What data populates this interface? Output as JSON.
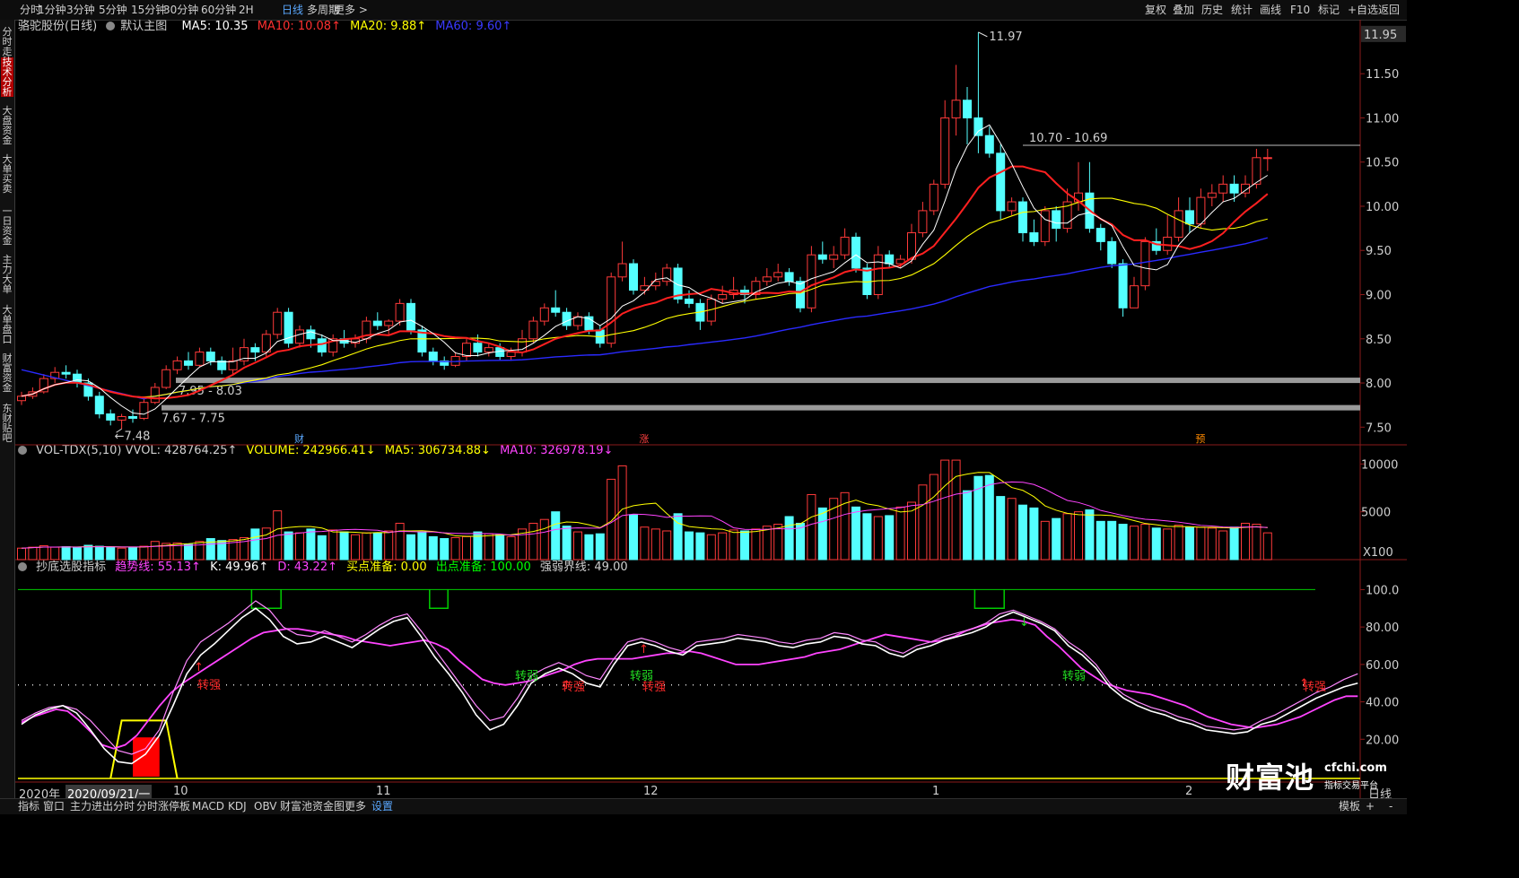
{
  "toolbar": {
    "periods": [
      "分时",
      "1分钟",
      "3分钟",
      "5分钟",
      "15分钟",
      "30分钟",
      "60分钟",
      "2H",
      "日线",
      "多周期",
      "更多 >"
    ],
    "active_period": "日线",
    "right_buttons": [
      "复权",
      "叠加",
      "历史",
      "统计",
      "画线",
      "F10",
      "标记",
      "+自选",
      "返回"
    ]
  },
  "sidebar": {
    "items": [
      "分时走势",
      "技术分析",
      "大盘资金",
      "大单买卖",
      "一日资金",
      "主力大单",
      "大单盘口",
      "财富资金",
      "东财贴吧"
    ],
    "active_item": "技术分析"
  },
  "main_panel": {
    "stock": "骆驼股份(日线)",
    "template": "默认主图",
    "ma5": "MA5: 10.35",
    "ma10": "MA10: 10.08↑",
    "ma20": "MA20: 9.88↑",
    "ma60": "MA60: 9.60↑",
    "price_current": "11.95",
    "high_label": "11.97",
    "low_label": "7.48",
    "zone_top": "10.70 - 10.69",
    "zone_mid": "7.95 - 8.03",
    "zone_low": "7.67 - 7.75",
    "markers": [
      "财",
      "涨",
      "预"
    ],
    "y_ticks": [
      "11.50",
      "11.00",
      "10.50",
      "10.00",
      "9.50",
      "9.00",
      "8.50",
      "8.00",
      "7.50"
    ]
  },
  "volume_panel": {
    "name": "VOL-TDX(5,10)",
    "vvol": "VVOL: 428764.25↑",
    "volume": "VOLUME: 242966.41↓",
    "ma5": "MA5: 306734.88↓",
    "ma10": "MA10: 326978.19↓",
    "y_ticks": [
      "10000",
      "5000"
    ],
    "unit": "X100"
  },
  "indicator_panel": {
    "name": "抄底选股指标",
    "trend": "趋势线: 55.13↑",
    "k": "K: 49.96↑",
    "d": "D: 43.22↑",
    "buy_prep": "买点准备: 0.00",
    "exit_prep": "出点准备: 100.00",
    "strength": "强弱界线: 49.00",
    "y_ticks": [
      "100.0",
      "80.00",
      "60.00",
      "40.00",
      "20.00"
    ],
    "signals": [
      "转强",
      "转弱",
      "转强",
      "转弱",
      "转强",
      "转弱",
      "转强"
    ]
  },
  "x_axis": {
    "year": "2020年",
    "cursor_date": "2020/09/21/一",
    "months": [
      "10",
      "11",
      "12",
      "1",
      "2"
    ],
    "period": "日线"
  },
  "bottom_tabs": [
    "指标",
    "窗口",
    "主力进出分时",
    "分时涨停板",
    "MACD",
    "KDJ",
    "OBV",
    "财富池资金图",
    "更多",
    "设置"
  ],
  "bottom_active": "设置",
  "bottom_right": [
    "模板",
    "+",
    "-"
  ],
  "watermark": {
    "brand": "财富池",
    "domain": "cfchi.com",
    "sub": "指标交易平台"
  },
  "colors": {
    "up": "#ff3a3a",
    "down": "#54ffff",
    "ma5": "#ffffff",
    "ma10": "#ff2020",
    "ma20": "#ffff00",
    "ma60": "#2a2aff",
    "kline": "#ff44ff",
    "signal_green": "#00ff00"
  },
  "chart_data": {
    "type": "candlestick",
    "title": "骆驼股份(日线)",
    "ylim": [
      7.3,
      12.05
    ],
    "start_date": "2020-09-01",
    "candles": [
      [
        7.8,
        7.85,
        7.9,
        7.75
      ],
      [
        7.85,
        7.9,
        7.95,
        7.82
      ],
      [
        7.9,
        8.05,
        8.1,
        7.88
      ],
      [
        8.05,
        8.12,
        8.18,
        8.0
      ],
      [
        8.12,
        8.1,
        8.2,
        8.05
      ],
      [
        8.1,
        8.0,
        8.15,
        7.95
      ],
      [
        8.0,
        7.85,
        8.05,
        7.8
      ],
      [
        7.85,
        7.65,
        7.9,
        7.6
      ],
      [
        7.65,
        7.58,
        7.7,
        7.52
      ],
      [
        7.58,
        7.62,
        7.65,
        7.48
      ],
      [
        7.62,
        7.6,
        7.7,
        7.55
      ],
      [
        7.6,
        7.78,
        7.82,
        7.58
      ],
      [
        7.78,
        7.95,
        8.0,
        7.76
      ],
      [
        7.95,
        8.15,
        8.2,
        7.93
      ],
      [
        8.15,
        8.25,
        8.3,
        8.1
      ],
      [
        8.25,
        8.2,
        8.35,
        8.15
      ],
      [
        8.2,
        8.35,
        8.4,
        8.18
      ],
      [
        8.35,
        8.25,
        8.4,
        8.2
      ],
      [
        8.25,
        8.15,
        8.3,
        8.1
      ],
      [
        8.15,
        8.25,
        8.4,
        8.1
      ],
      [
        8.25,
        8.4,
        8.5,
        8.2
      ],
      [
        8.4,
        8.35,
        8.45,
        8.25
      ],
      [
        8.35,
        8.55,
        8.6,
        8.3
      ],
      [
        8.55,
        8.8,
        8.85,
        8.5
      ],
      [
        8.8,
        8.45,
        8.85,
        8.4
      ],
      [
        8.45,
        8.6,
        8.65,
        8.4
      ],
      [
        8.6,
        8.5,
        8.65,
        8.4
      ],
      [
        8.5,
        8.35,
        8.55,
        8.3
      ],
      [
        8.35,
        8.5,
        8.55,
        8.3
      ],
      [
        8.5,
        8.45,
        8.6,
        8.4
      ],
      [
        8.45,
        8.5,
        8.55,
        8.4
      ],
      [
        8.5,
        8.7,
        8.75,
        8.45
      ],
      [
        8.7,
        8.65,
        8.8,
        8.6
      ],
      [
        8.65,
        8.7,
        8.72,
        8.55
      ],
      [
        8.7,
        8.9,
        8.95,
        8.65
      ],
      [
        8.9,
        8.6,
        8.95,
        8.55
      ],
      [
        8.6,
        8.35,
        8.65,
        8.3
      ],
      [
        8.35,
        8.25,
        8.4,
        8.2
      ],
      [
        8.25,
        8.2,
        8.3,
        8.15
      ],
      [
        8.2,
        8.3,
        8.35,
        8.18
      ],
      [
        8.3,
        8.45,
        8.5,
        8.25
      ],
      [
        8.45,
        8.35,
        8.55,
        8.3
      ],
      [
        8.35,
        8.4,
        8.45,
        8.3
      ],
      [
        8.4,
        8.3,
        8.45,
        8.25
      ],
      [
        8.3,
        8.35,
        8.4,
        8.25
      ],
      [
        8.35,
        8.5,
        8.6,
        8.3
      ],
      [
        8.5,
        8.7,
        8.75,
        8.45
      ],
      [
        8.7,
        8.85,
        8.9,
        8.65
      ],
      [
        8.85,
        8.8,
        9.05,
        8.75
      ],
      [
        8.8,
        8.65,
        8.85,
        8.6
      ],
      [
        8.65,
        8.75,
        8.8,
        8.6
      ],
      [
        8.75,
        8.6,
        8.8,
        8.55
      ],
      [
        8.6,
        8.45,
        8.65,
        8.4
      ],
      [
        8.45,
        9.2,
        9.25,
        8.4
      ],
      [
        9.2,
        9.35,
        9.6,
        9.15
      ],
      [
        9.35,
        9.05,
        9.4,
        9.0
      ],
      [
        9.05,
        9.1,
        9.2,
        9.0
      ],
      [
        9.1,
        9.15,
        9.25,
        9.05
      ],
      [
        9.15,
        9.3,
        9.35,
        9.1
      ],
      [
        9.3,
        8.95,
        9.35,
        8.9
      ],
      [
        8.95,
        8.9,
        9.05,
        8.85
      ],
      [
        8.9,
        8.7,
        8.95,
        8.6
      ],
      [
        8.7,
        8.95,
        9.0,
        8.65
      ],
      [
        8.95,
        9.0,
        9.1,
        8.9
      ],
      [
        9.0,
        9.05,
        9.2,
        8.95
      ],
      [
        9.05,
        9.0,
        9.1,
        8.9
      ],
      [
        9.0,
        9.15,
        9.2,
        8.95
      ],
      [
        9.15,
        9.2,
        9.3,
        9.1
      ],
      [
        9.2,
        9.25,
        9.35,
        9.15
      ],
      [
        9.25,
        9.15,
        9.3,
        9.1
      ],
      [
        9.15,
        8.85,
        9.2,
        8.8
      ],
      [
        8.85,
        9.45,
        9.55,
        8.8
      ],
      [
        9.45,
        9.4,
        9.6,
        9.35
      ],
      [
        9.4,
        9.45,
        9.55,
        9.3
      ],
      [
        9.45,
        9.65,
        9.75,
        9.4
      ],
      [
        9.65,
        9.3,
        9.7,
        9.25
      ],
      [
        9.3,
        9.0,
        9.35,
        8.95
      ],
      [
        9.0,
        9.45,
        9.55,
        8.95
      ],
      [
        9.45,
        9.35,
        9.5,
        9.3
      ],
      [
        9.35,
        9.4,
        9.45,
        9.3
      ],
      [
        9.4,
        9.7,
        9.8,
        9.35
      ],
      [
        9.7,
        9.95,
        10.05,
        9.65
      ],
      [
        9.95,
        10.25,
        10.3,
        9.9
      ],
      [
        10.25,
        11.0,
        11.2,
        10.2
      ],
      [
        11.0,
        11.2,
        11.6,
        10.8
      ],
      [
        11.2,
        11.0,
        11.35,
        10.7
      ],
      [
        11.0,
        10.8,
        11.97,
        10.6
      ],
      [
        10.8,
        10.6,
        10.9,
        10.55
      ],
      [
        10.6,
        9.95,
        10.7,
        9.85
      ],
      [
        9.95,
        10.05,
        10.1,
        9.9
      ],
      [
        10.05,
        9.7,
        10.1,
        9.6
      ],
      [
        9.7,
        9.6,
        9.85,
        9.55
      ],
      [
        9.6,
        9.95,
        10.0,
        9.55
      ],
      [
        9.95,
        9.75,
        10.0,
        9.6
      ],
      [
        9.75,
        10.05,
        10.2,
        9.7
      ],
      [
        10.05,
        10.15,
        10.5,
        9.95
      ],
      [
        10.15,
        9.75,
        10.5,
        9.7
      ],
      [
        9.75,
        9.6,
        9.8,
        9.5
      ],
      [
        9.6,
        9.35,
        9.65,
        9.3
      ],
      [
        9.35,
        8.85,
        9.4,
        8.75
      ],
      [
        8.85,
        9.1,
        9.2,
        8.85
      ],
      [
        9.1,
        9.6,
        9.65,
        9.05
      ],
      [
        9.6,
        9.5,
        9.75,
        9.45
      ],
      [
        9.5,
        9.65,
        9.9,
        9.45
      ],
      [
        9.65,
        9.95,
        10.1,
        9.6
      ],
      [
        9.95,
        9.8,
        10.1,
        9.7
      ],
      [
        9.8,
        10.1,
        10.2,
        9.75
      ],
      [
        10.1,
        10.15,
        10.25,
        10.0
      ],
      [
        10.15,
        10.25,
        10.35,
        10.05
      ],
      [
        10.25,
        10.15,
        10.35,
        10.05
      ],
      [
        10.15,
        10.25,
        10.35,
        10.1
      ],
      [
        10.25,
        10.55,
        10.65,
        10.2
      ],
      [
        10.55,
        10.55,
        10.65,
        10.4
      ]
    ],
    "volume": [
      1200,
      1300,
      1450,
      1300,
      1350,
      1250,
      1500,
      1400,
      1300,
      1200,
      1250,
      1400,
      1900,
      1700,
      1750,
      1600,
      1900,
      2200,
      2000,
      2100,
      2300,
      3200,
      3300,
      5100,
      2900,
      2800,
      3200,
      2500,
      3100,
      2900,
      2600,
      2800,
      2800,
      3000,
      3800,
      2600,
      2900,
      2400,
      2200,
      2300,
      2400,
      2900,
      2700,
      2600,
      2400,
      3200,
      3800,
      4200,
      5000,
      3500,
      2900,
      2600,
      2700,
      8400,
      9800,
      4700,
      3400,
      3200,
      3000,
      4800,
      2900,
      2800,
      2600,
      2800,
      3100,
      3000,
      3200,
      3500,
      3700,
      4500,
      3800,
      6800,
      5400,
      6400,
      7000,
      5500,
      4800,
      4500,
      4600,
      5500,
      6000,
      7800,
      8900,
      10400,
      10400,
      7200,
      8700,
      8800,
      6600,
      6400,
      5700,
      5400,
      4000,
      4300,
      4800,
      5000,
      5200,
      4000,
      4000,
      3700,
      3500,
      3700,
      3300,
      3200,
      3600,
      3400,
      3400,
      3300,
      3000,
      3400,
      3800,
      3700,
      2800
    ],
    "kline_d": [
      29,
      32,
      34,
      36,
      35,
      30,
      24,
      17,
      15,
      17,
      22,
      30,
      38,
      45,
      50,
      54,
      58,
      62,
      66,
      70,
      74,
      77,
      78,
      79,
      79,
      78,
      77,
      76,
      75,
      73,
      72,
      71,
      70,
      71,
      72,
      73,
      71,
      68,
      62,
      57,
      52,
      50,
      49,
      50,
      51,
      53,
      55,
      57,
      60,
      62,
      63,
      63,
      63,
      63,
      64,
      65,
      66,
      66,
      67,
      66,
      64,
      62,
      60,
      60,
      60,
      61,
      62,
      63,
      64,
      66,
      67,
      68,
      70,
      72,
      74,
      76,
      75,
      74,
      73,
      72,
      73,
      75,
      78,
      80,
      82,
      83,
      84,
      83,
      81,
      75,
      70,
      64,
      58,
      54,
      50,
      48,
      46,
      45,
      44,
      42,
      40,
      38,
      35,
      32,
      30,
      28,
      27,
      26,
      27,
      28,
      30,
      32,
      35,
      38,
      41,
      43,
      43
    ],
    "kline_k": [
      28,
      33,
      36,
      38,
      34,
      25,
      15,
      8,
      7,
      12,
      22,
      38,
      55,
      65,
      71,
      78,
      85,
      90,
      84,
      75,
      71,
      72,
      75,
      72,
      69,
      74,
      79,
      83,
      85,
      75,
      64,
      55,
      45,
      33,
      25,
      28,
      38,
      50,
      55,
      58,
      55,
      50,
      48,
      60,
      70,
      72,
      70,
      67,
      65,
      70,
      71,
      72,
      74,
      73,
      72,
      70,
      69,
      71,
      72,
      75,
      74,
      71,
      70,
      66,
      64,
      68,
      70,
      73,
      75,
      77,
      80,
      85,
      88,
      85,
      82,
      78,
      70,
      65,
      58,
      48,
      42,
      38,
      35,
      33,
      30,
      28,
      25,
      24,
      23,
      24,
      28,
      30,
      34,
      38,
      42,
      45,
      48,
      50
    ],
    "kline_trend": [
      30,
      34,
      37,
      38,
      36,
      30,
      22,
      14,
      12,
      15,
      25,
      45,
      62,
      72,
      77,
      82,
      88,
      94,
      89,
      80,
      76,
      75,
      78,
      75,
      72,
      76,
      81,
      85,
      87,
      78,
      68,
      58,
      48,
      38,
      30,
      32,
      42,
      54,
      58,
      61,
      58,
      54,
      52,
      63,
      72,
      74,
      72,
      69,
      67,
      72,
      73,
      74,
      76,
      75,
      74,
      72,
      71,
      73,
      74,
      77,
      76,
      73,
      72,
      68,
      66,
      70,
      72,
      75,
      77,
      79,
      82,
      87,
      89,
      86,
      83,
      79,
      72,
      67,
      60,
      50,
      44,
      40,
      37,
      35,
      32,
      30,
      27,
      26,
      25,
      26,
      30,
      33,
      37,
      41,
      45,
      48,
      52,
      55
    ],
    "reference_line": 49
  }
}
